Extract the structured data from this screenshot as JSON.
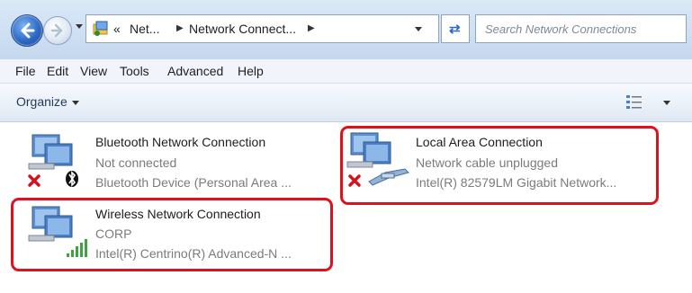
{
  "address": {
    "crumbs": [
      "«",
      "Net...",
      "Network Connect..."
    ],
    "search_placeholder": "Search Network Connections"
  },
  "menu": [
    "File",
    "Edit",
    "View",
    "Tools",
    "Advanced",
    "Help"
  ],
  "command_bar": {
    "organize_label": "Organize"
  },
  "connections": [
    {
      "name": "Bluetooth Network Connection",
      "status": "Not connected",
      "device": "Bluetooth Device (Personal Area ...",
      "icon": "bluetooth-network-icon",
      "highlighted": false
    },
    {
      "name": "Local Area Connection",
      "status": "Network cable unplugged",
      "device": "Intel(R) 82579LM Gigabit Network...",
      "icon": "ethernet-network-icon",
      "highlighted": true
    },
    {
      "name": "Wireless Network Connection",
      "status": "CORP",
      "device": "Intel(R) Centrino(R) Advanced-N ...",
      "icon": "wireless-network-icon",
      "highlighted": true
    }
  ],
  "colors": {
    "highlight": "#e0101d",
    "accent": "#2b69c6"
  }
}
